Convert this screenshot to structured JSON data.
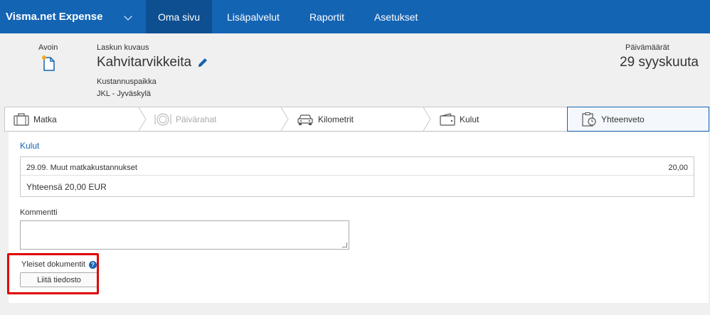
{
  "app": {
    "brand": "Visma.net Expense",
    "nav": [
      "Oma sivu",
      "Lisäpalvelut",
      "Raportit",
      "Asetukset"
    ],
    "active_nav": "Oma sivu"
  },
  "header": {
    "status": "Avoin",
    "description_label": "Laskun kuvaus",
    "title": "Kahvitarvikkeita",
    "cost_center_label": "Kustannuspaikka",
    "cost_center_value": "JKL - Jyväskylä",
    "dates_label": "Päivämäärät",
    "dates_value": "29 syyskuuta"
  },
  "steps": [
    {
      "label": "Matka",
      "icon": "suitcase-icon",
      "disabled": false
    },
    {
      "label": "Päivärahat",
      "icon": "plate-icon",
      "disabled": true
    },
    {
      "label": "Kilometrit",
      "icon": "car-icon",
      "disabled": false
    },
    {
      "label": "Kulut",
      "icon": "wallet-icon",
      "disabled": false
    },
    {
      "label": "Yhteenveto",
      "icon": "summary-icon",
      "disabled": false,
      "active": true
    }
  ],
  "summary": {
    "section_title": "Kulut",
    "expense_row": "29.09. Muut matkakustannukset",
    "expense_amount": "20,00",
    "total": "Yhteensä 20,00 EUR"
  },
  "comment": {
    "label": "Kommentti",
    "value": ""
  },
  "documents": {
    "label": "Yleiset dokumentit",
    "help": "?",
    "attach_button": "Liitä tiedosto"
  },
  "colors": {
    "primary": "#1464b4",
    "nav_active": "#0d4f91",
    "highlight": "#e00000"
  }
}
